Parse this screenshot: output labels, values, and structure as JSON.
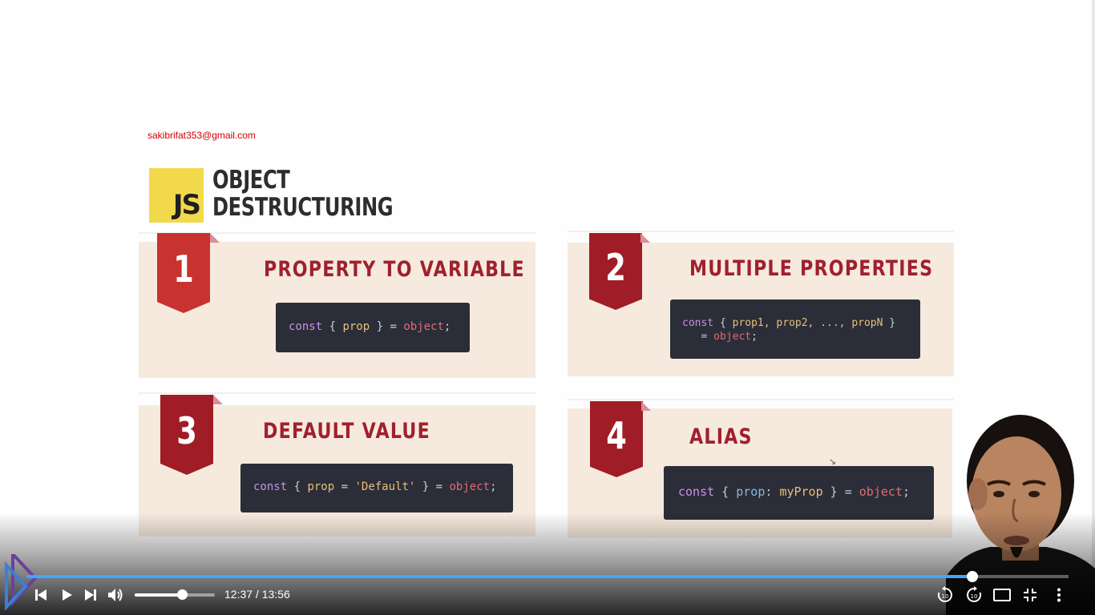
{
  "watermark": "sakibrifat353@gmail.com",
  "slide": {
    "logo_text": "JS",
    "title_line1": "OBJECT",
    "title_line2": "DESTRUCTURING",
    "cards": [
      {
        "number": "1",
        "heading": "PROPERTY TO VARIABLE",
        "code": {
          "kw": "const",
          "open": " { ",
          "prop": "prop",
          "close": " } = ",
          "obj": "object",
          "end": ";"
        }
      },
      {
        "number": "2",
        "heading": "MULTIPLE PROPERTIES",
        "code": {
          "kw": "const",
          "open": " { ",
          "props": "prop1, prop2, ..., propN",
          "close": " }",
          "eq": "= ",
          "obj": "object",
          "end": ";"
        }
      },
      {
        "number": "3",
        "heading": "DEFAULT VALUE",
        "code": {
          "kw": "const",
          "open": " { ",
          "prop": "prop",
          "eq": " = ",
          "str": "'Default'",
          "close": " } = ",
          "obj": "object",
          "end": ";"
        }
      },
      {
        "number": "4",
        "heading": "ALIAS",
        "code": {
          "kw": "const",
          "open": " { ",
          "prop": "prop",
          "colon": ": ",
          "alias": "myProp",
          "close": " } = ",
          "obj": "object",
          "end": ";"
        }
      }
    ]
  },
  "player": {
    "current_time": "12:37",
    "duration": "13:56",
    "time_display": "12:37 / 13:56",
    "progress_fraction": 0.9079,
    "volume_fraction": 0.59,
    "icons": [
      "previous-icon",
      "play-icon",
      "next-icon",
      "volume-icon",
      "rewind-10-icon",
      "forward-10-icon",
      "theater-mode-icon",
      "exit-fullscreen-icon",
      "more-options-icon"
    ],
    "accent_color": "#3ea6ff"
  },
  "colors": {
    "ribbon_red": "#c8322f",
    "ribbon_dark_red": "#a01c26",
    "card_bg": "#f6eade",
    "heading": "#a0202e",
    "code_bg": "#2b2d38",
    "js_yellow": "#f1d94b"
  }
}
